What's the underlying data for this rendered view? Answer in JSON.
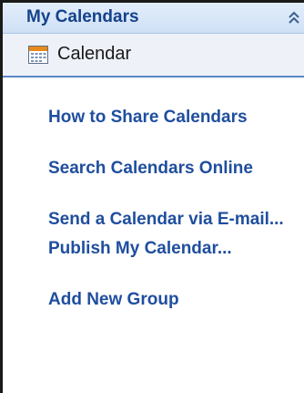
{
  "panel": {
    "title": "My Calendars",
    "collapse_icon": "double-chevron-up-icon"
  },
  "calendar_item": {
    "label": "Calendar",
    "icon": "calendar-icon"
  },
  "links": [
    {
      "label": "How to Share Calendars"
    },
    {
      "label": "Search Calendars Online"
    },
    {
      "label": "Send a Calendar via E-mail..."
    },
    {
      "label": "Publish My Calendar..."
    },
    {
      "label": "Add New Group"
    }
  ],
  "colors": {
    "header_text": "#15428b",
    "link_text": "#1f4e9e",
    "accent_line": "#5a86c8"
  }
}
